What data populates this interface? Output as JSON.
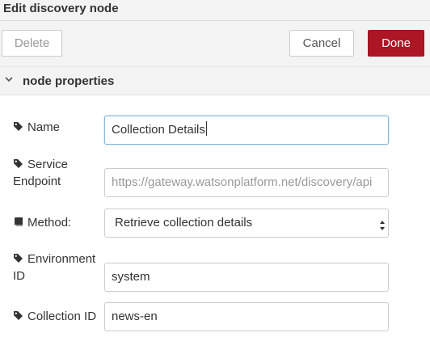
{
  "dialog": {
    "title": "Edit discovery node"
  },
  "toolbar": {
    "delete_label": "Delete",
    "cancel_label": "Cancel",
    "done_label": "Done"
  },
  "section": {
    "label": "node properties",
    "expanded": true
  },
  "form": {
    "name": {
      "label": "Name",
      "value": "Collection Details",
      "icon": "tag-icon"
    },
    "service_endpoint": {
      "label_line1": "Service",
      "label_line2": "Endpoint",
      "placeholder": "https://gateway.watsonplatform.net/discovery/api",
      "icon": "tag-icon"
    },
    "method": {
      "label": "Method:",
      "selected": "Retrieve collection details",
      "icon": "book-icon"
    },
    "environment_id": {
      "label_line1": "Environment",
      "label_line2": "ID",
      "value": "system",
      "icon": "tag-icon"
    },
    "collection_id": {
      "label": "Collection ID",
      "value": "news-en",
      "icon": "tag-icon"
    }
  },
  "colors": {
    "primary_button": "#ad1625",
    "focus_border": "#85b7d9"
  }
}
